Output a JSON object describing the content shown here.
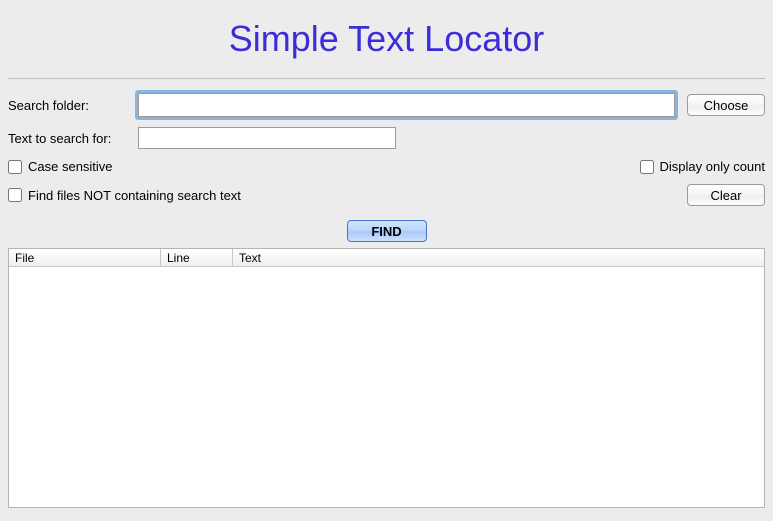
{
  "title": "Simple Text Locator",
  "labels": {
    "search_folder": "Search folder:",
    "text_to_search": "Text to search for:"
  },
  "inputs": {
    "folder_value": "",
    "text_value": ""
  },
  "buttons": {
    "choose": "Choose",
    "clear": "Clear",
    "find": "FIND"
  },
  "options": {
    "case_sensitive": {
      "label": "Case sensitive",
      "checked": false
    },
    "display_only_count": {
      "label": "Display only count",
      "checked": false
    },
    "find_not_containing": {
      "label": "Find files NOT containing search text",
      "checked": false
    }
  },
  "results": {
    "columns": {
      "file": "File",
      "line": "Line",
      "text": "Text"
    },
    "rows": []
  }
}
